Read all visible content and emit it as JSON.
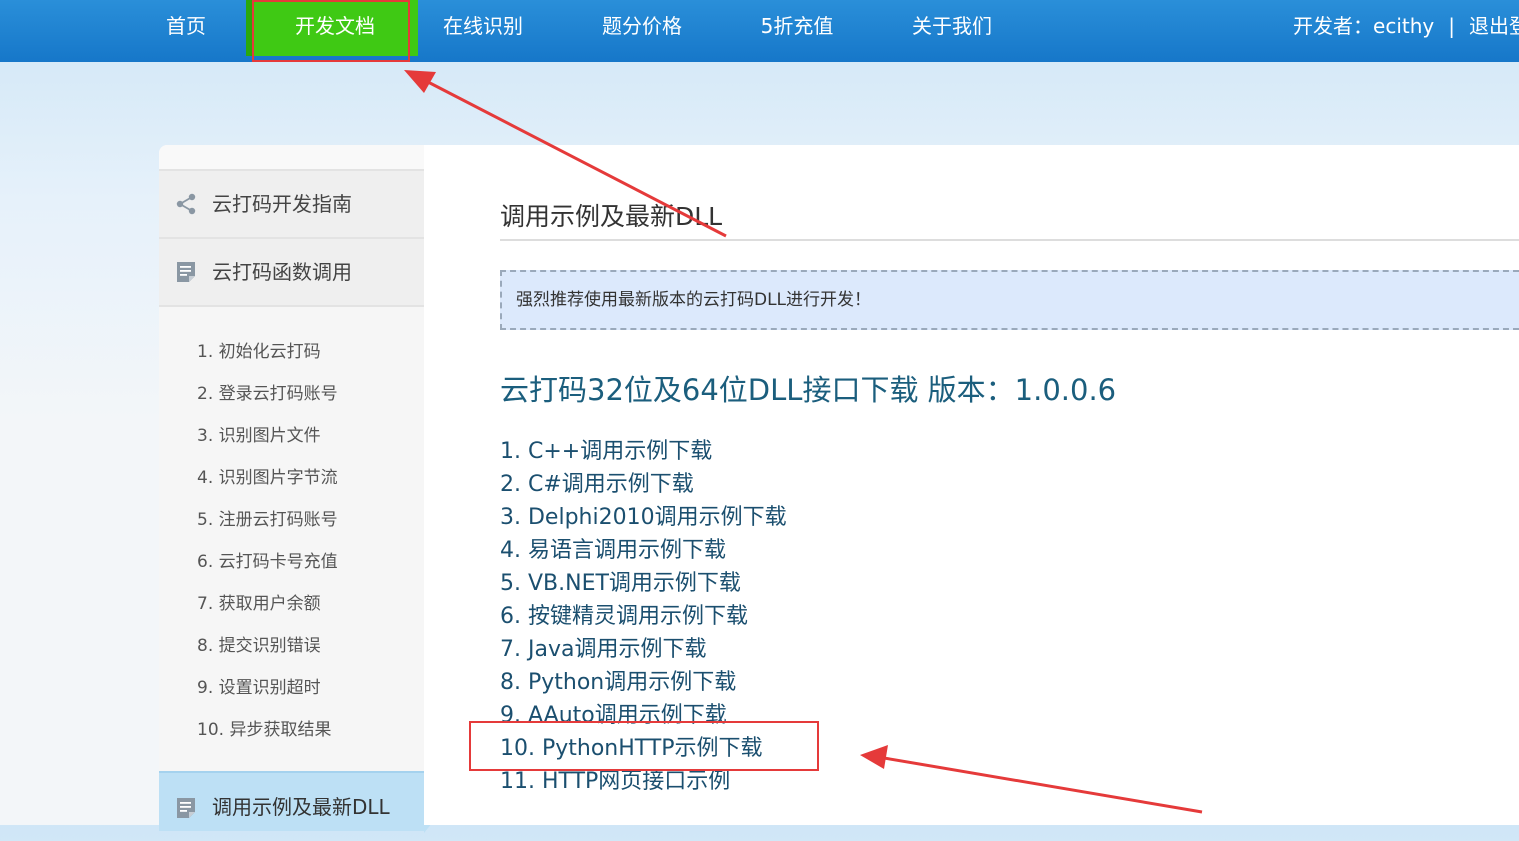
{
  "nav": {
    "items": [
      {
        "label": "首页"
      },
      {
        "label": "开发文档"
      },
      {
        "label": "在线识别"
      },
      {
        "label": "题分价格"
      },
      {
        "label": "5折充值"
      },
      {
        "label": "关于我们"
      }
    ],
    "developer_label": "开发者：ecithy",
    "divider": "|",
    "logout_label": "退出登录",
    "active_index": 1,
    "colors": {
      "bar": "#1677c9",
      "active": "#3fc914"
    }
  },
  "sidebar": {
    "sections": [
      {
        "label": "云打码开发指南",
        "icon": "share-icon"
      },
      {
        "label": "云打码函数调用",
        "icon": "document-icon"
      }
    ],
    "sub_items": [
      "1. 初始化云打码",
      "2. 登录云打码账号",
      "3. 识别图片文件",
      "4. 识别图片字节流",
      "5. 注册云打码账号",
      "6. 云打码卡号充值",
      "7. 获取用户余额",
      "8. 提交识别错误",
      "9. 设置识别超时",
      "10. 异步获取结果"
    ],
    "active_section": {
      "label": "调用示例及最新DLL",
      "icon": "document-icon"
    }
  },
  "main": {
    "title": "调用示例及最新DLL",
    "notice": "强烈推荐使用最新版本的云打码DLL进行开发！",
    "download_title": "云打码32位及64位DLL接口下载 版本：1.0.0.6",
    "downloads": [
      "1. C++调用示例下载",
      "2. C#调用示例下载",
      "3. Delphi2010调用示例下载",
      "4. 易语言调用示例下载",
      "5. VB.NET调用示例下载",
      "6. 按键精灵调用示例下载",
      "7. Java调用示例下载",
      "8. Python调用示例下载",
      "9. AAuto调用示例下载",
      "10. PythonHTTP示例下载",
      "11. HTTP网页接口示例"
    ]
  },
  "annotations": {
    "color": "#e53a3a"
  }
}
